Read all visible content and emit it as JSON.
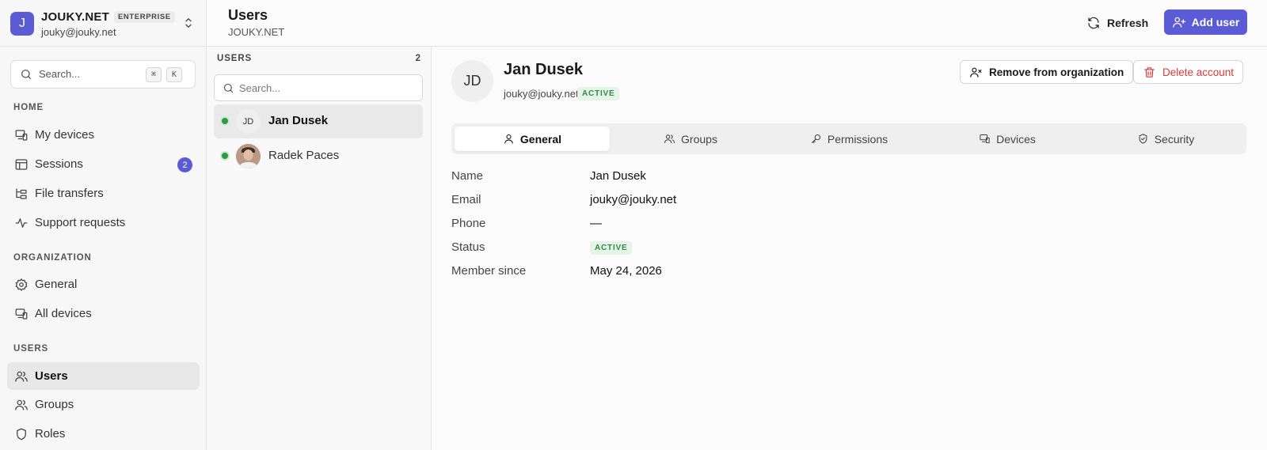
{
  "org": {
    "initial": "J",
    "name": "JOUKY.NET",
    "plan_badge": "ENTERPRISE",
    "email": "jouky@jouky.net"
  },
  "sidebar": {
    "search_placeholder": "Search...",
    "shortcut_keys": [
      "⌘",
      "K"
    ],
    "sections": [
      {
        "title": "HOME",
        "items": [
          {
            "label": "My devices",
            "icon": "devices-icon"
          },
          {
            "label": "Sessions",
            "icon": "sessions-icon",
            "badge": "2"
          },
          {
            "label": "File transfers",
            "icon": "file-transfer-icon"
          },
          {
            "label": "Support requests",
            "icon": "activity-icon"
          }
        ]
      },
      {
        "title": "ORGANIZATION",
        "items": [
          {
            "label": "General",
            "icon": "gear-icon"
          },
          {
            "label": "All devices",
            "icon": "devices-icon"
          }
        ]
      },
      {
        "title": "USERS",
        "items": [
          {
            "label": "Users",
            "icon": "users-icon",
            "active": true
          },
          {
            "label": "Groups",
            "icon": "groups-icon"
          },
          {
            "label": "Roles",
            "icon": "shield-icon"
          }
        ]
      }
    ]
  },
  "header": {
    "title": "Users",
    "subtitle": "JOUKY.NET",
    "refresh_label": "Refresh",
    "add_user_label": "Add user"
  },
  "user_list": {
    "heading": "USERS",
    "count": "2",
    "search_placeholder": "Search...",
    "users": [
      {
        "name": "Jan Dusek",
        "initials": "JD",
        "online": true,
        "selected": true
      },
      {
        "name": "Radek Paces",
        "initials": "",
        "online": true,
        "selected": false,
        "has_photo": true
      }
    ]
  },
  "detail": {
    "initials": "JD",
    "name": "Jan Dusek",
    "email": "jouky@jouky.net",
    "status_badge": "ACTIVE",
    "remove_label": "Remove from organization",
    "delete_label": "Delete account",
    "tabs": [
      {
        "label": "General",
        "icon": "user-icon",
        "active": true
      },
      {
        "label": "Groups",
        "icon": "groups-icon"
      },
      {
        "label": "Permissions",
        "icon": "key-icon"
      },
      {
        "label": "Devices",
        "icon": "devices-icon"
      },
      {
        "label": "Security",
        "icon": "shield-check-icon"
      }
    ],
    "fields": [
      {
        "label": "Name",
        "value": "Jan Dusek"
      },
      {
        "label": "Email",
        "value": "jouky@jouky.net"
      },
      {
        "label": "Phone",
        "value": "—"
      },
      {
        "label": "Status",
        "value": "ACTIVE",
        "is_badge": true
      },
      {
        "label": "Member since",
        "value": "May 24, 2026"
      }
    ]
  },
  "colors": {
    "accent": "#5b5bd6",
    "success": "#2e9a44",
    "danger": "#d93a3a"
  }
}
